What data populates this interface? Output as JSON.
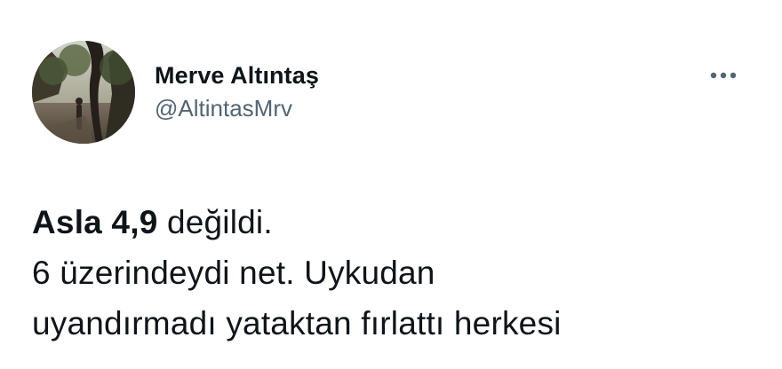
{
  "tweet": {
    "author": {
      "display_name": "Merve Altıntaş",
      "handle": "@AltintasMrv",
      "avatar_icon": "profile-photo"
    },
    "more_icon": "more-horizontal-icon",
    "text": {
      "line1_bold": "Asla 4,9",
      "line1_rest": " değildi.",
      "line2": "6 üzerindeydi net. Uykudan",
      "line3": "uyandırmadı yataktan fırlattı herkesi"
    }
  },
  "colors": {
    "text_primary": "#0f1419",
    "text_secondary": "#536471",
    "background": "#ffffff"
  }
}
